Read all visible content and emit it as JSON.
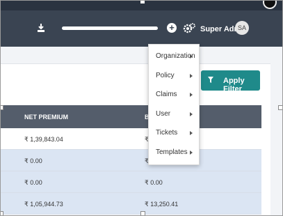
{
  "header": {
    "user_name": "Super Admin",
    "avatar_initials": "SA",
    "plus_glyph": "+",
    "download_icon": "download-icon",
    "settings_icon": "gears-icon"
  },
  "actions": {
    "apply_filter": "Apply Filter",
    "filter_icon": "funnel-icon"
  },
  "table": {
    "columns": [
      "NET PREMIUM",
      "B"
    ],
    "rows": [
      [
        "₹ 1,39,843.04",
        "₹"
      ],
      [
        "₹ 0.00",
        "₹ 0.00"
      ],
      [
        "₹ 0.00",
        "₹ 0.00"
      ],
      [
        "₹ 1,05,944.73",
        "₹ 13,250.41"
      ]
    ]
  },
  "menu": {
    "items": [
      "Organization",
      "Policy",
      "Claims",
      "User",
      "Tickets",
      "Templates"
    ]
  },
  "colors": {
    "header_bg": "#3a4452",
    "accent": "#1f8a8a",
    "table_header_bg": "#545d6b",
    "row_alt_bg": "#dbe5f3"
  }
}
